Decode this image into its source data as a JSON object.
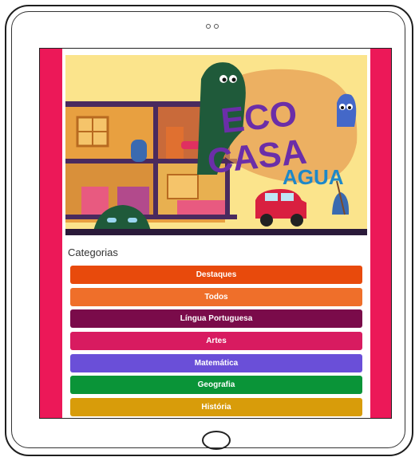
{
  "hero": {
    "title_line1": "ECO",
    "title_line2": "CASA",
    "title_line3": "AGUA"
  },
  "categories_section": {
    "title": "Categorias",
    "items": [
      {
        "label": "Destaques",
        "color": "#e84a0c"
      },
      {
        "label": "Todos",
        "color": "#ef6f2a"
      },
      {
        "label": "Língua Portuguesa",
        "color": "#7a0b4a"
      },
      {
        "label": "Artes",
        "color": "#d81b60"
      },
      {
        "label": "Matemática",
        "color": "#6a4fd8"
      },
      {
        "label": "Geografia",
        "color": "#0a9438"
      },
      {
        "label": "História",
        "color": "#d89c0a"
      }
    ]
  },
  "colors": {
    "side_frame": "#ec1858",
    "hero_background": "#fbe48c",
    "logo_purple": "#6b2ea8",
    "logo_blue": "#1e88c8"
  },
  "icons": [
    "camera-dots",
    "home-button-icon"
  ]
}
